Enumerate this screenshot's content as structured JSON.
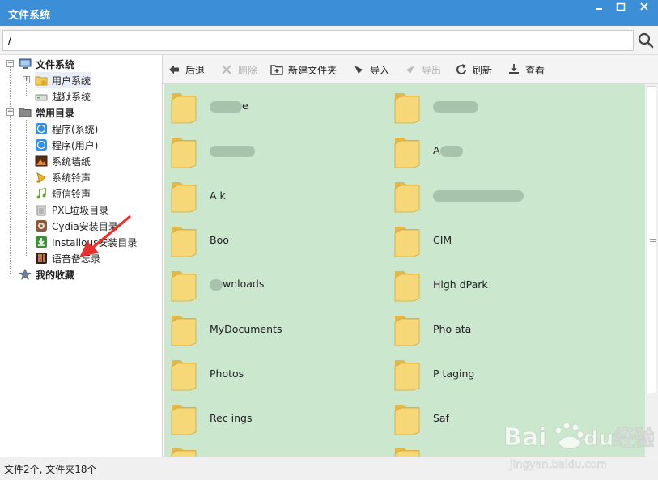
{
  "window": {
    "title": "文件系统"
  },
  "path": {
    "value": "/"
  },
  "tree": {
    "root": "文件系统",
    "user_system": "用户系统",
    "jailbreak_system": "越狱系统",
    "common_dirs": "常用目录",
    "items": [
      "程序(系统)",
      "程序(用户)",
      "系统墙纸",
      "系统铃声",
      "短信铃声",
      "PXL垃圾目录",
      "Cydia安装目录",
      "Installous安装目录",
      "语音备忘录"
    ],
    "favorites": "我的收藏"
  },
  "toolbar": {
    "back": "后退",
    "delete": "删除",
    "new_folder": "新建文件夹",
    "import": "导入",
    "export": "导出",
    "refresh": "刷新",
    "view": "查看"
  },
  "folders_left": [
    {
      "name": "e"
    },
    {
      "name": ""
    },
    {
      "name": "A k"
    },
    {
      "name": "Boo"
    },
    {
      "name": "wnloads"
    },
    {
      "name": "MyDocuments"
    },
    {
      "name": "Photos"
    },
    {
      "name": "Rec ings"
    }
  ],
  "folders_right": [
    {
      "name": ""
    },
    {
      "name": "A"
    },
    {
      "name": ""
    },
    {
      "name": "CIM"
    },
    {
      "name": "High dPark"
    },
    {
      "name": "Pho ata"
    },
    {
      "name": "P taging"
    },
    {
      "name": "Saf"
    }
  ],
  "status": {
    "text": "文件2个, 文件夹18个"
  },
  "watermark": {
    "brand": "Bai du经验",
    "url": "jingyan.baidu.com"
  },
  "colors": {
    "titlebar": "#3c8fd6",
    "content_bg": "#cbe8cf",
    "arrow": "#e8302c"
  }
}
